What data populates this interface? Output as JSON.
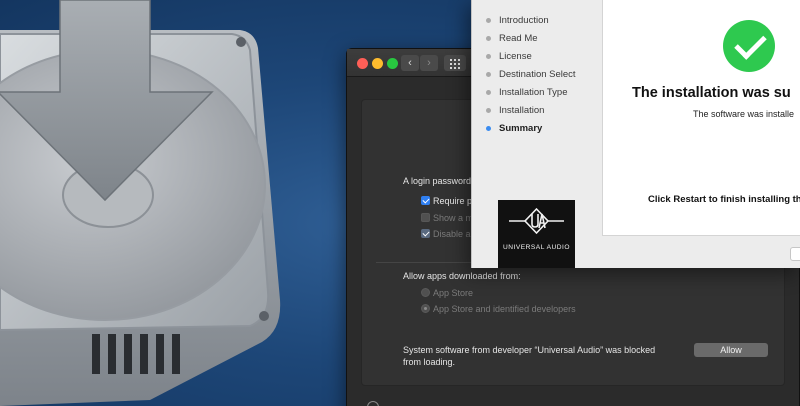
{
  "installer": {
    "steps": [
      {
        "label": "Introduction",
        "current": false
      },
      {
        "label": "Read Me",
        "current": false
      },
      {
        "label": "License",
        "current": false
      },
      {
        "label": "Destination Select",
        "current": false
      },
      {
        "label": "Installation Type",
        "current": false
      },
      {
        "label": "Installation",
        "current": false
      },
      {
        "label": "Summary",
        "current": true
      }
    ],
    "logo_text": "UNIVERSAL AUDIO",
    "heading": "The installation was su",
    "subtext": "The software was installe",
    "footer": "Click Restart to finish installing th",
    "accent_color": "#3b8cf0",
    "success_color": "#2ec94f"
  },
  "security": {
    "login_heading": "A login password",
    "options": [
      {
        "label": "Require p",
        "checked": true,
        "enabled": true
      },
      {
        "label": "Show a m",
        "checked": false,
        "enabled": false
      },
      {
        "label": "Disable a",
        "checked": true,
        "enabled": false
      }
    ],
    "allow_apps_label": "Allow apps downloaded from:",
    "radios": [
      {
        "label": "App Store",
        "selected": false
      },
      {
        "label": "App Store and identified developers",
        "selected": true
      }
    ],
    "blocked_line1": "System software from developer “Universal Audio” was blocked",
    "blocked_line2": "from loading.",
    "allow_button": "Allow"
  },
  "icons": {
    "back": "‹",
    "forward": "›"
  }
}
